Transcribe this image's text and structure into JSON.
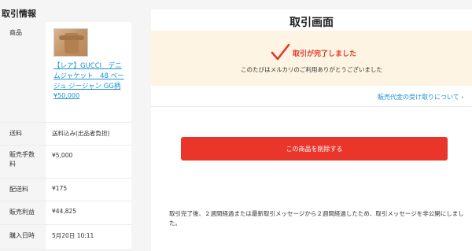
{
  "left_panel": {
    "title": "取引情報",
    "rows": {
      "product": {
        "label": "商品",
        "name": "【レア】GUCCI　デニムジャケット　48 ベージュ ジージャン GG柄",
        "price": "¥50,000"
      },
      "shipping": {
        "label": "送料",
        "value": "送料込み(出品者負担)"
      },
      "fee": {
        "label": "販売手数料",
        "value": "¥5,000"
      },
      "delivery": {
        "label": "配送料",
        "value": "¥175"
      },
      "profit": {
        "label": "販売利益",
        "value": "¥44,825"
      },
      "date": {
        "label": "購入日時",
        "value": "5月20日 10:11"
      }
    }
  },
  "main": {
    "title": "取引画面",
    "banner": {
      "status": "取引が完了しました",
      "message": "このたびはメルカリのご利用ありがとうございました"
    },
    "payment_link": "販売代金の受け取りについて ›",
    "delete_button": "この商品を削除する",
    "note": "取引完了後、２週間経過または最新取引メッセージから２週間経過したため、取引メッセージを非公開にしました。"
  },
  "icons": {
    "status_check": "checkmark-icon"
  },
  "colors": {
    "accent_red": "#ea352b",
    "link_blue": "#1a8fd6",
    "banner_bg": "#fdf4e3"
  }
}
